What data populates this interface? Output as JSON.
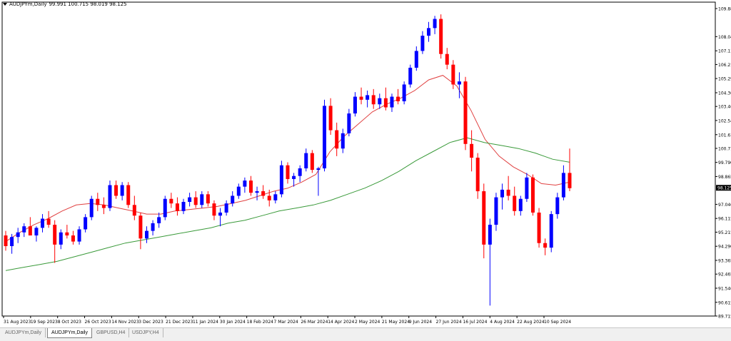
{
  "header": {
    "symbol": "AUDJPYm,Daily",
    "ohlc": "99.991 100.715 98.019 98.125"
  },
  "chart_data": {
    "type": "line",
    "title": "AUDJPYm,Daily",
    "ylim": [
      89.715,
      109.88
    ],
    "y_ticks": [
      "109.88",
      "108.04",
      "107.11",
      "106.21",
      "105.29",
      "104.36",
      "103.46",
      "102.54",
      "101.61",
      "100.71",
      "99.790",
      "98.865",
      "97.040",
      "96.115",
      "95.215",
      "94.290",
      "93.365",
      "92.465",
      "91.540",
      "90.615",
      "89.715"
    ],
    "x_ticks": [
      "31 Aug 2023",
      "19 Sep 2023",
      "8 Oct 2023",
      "26 Oct 2023",
      "14 Nov 2023",
      "3 Dec 2023",
      "21 Dec 2023",
      "11 Jan 2024",
      "30 Jan 2024",
      "18 Feb 2024",
      "7 Mar 2024",
      "26 Mar 2024",
      "14 Apr 2024",
      "2 May 2024",
      "21 May 2024",
      "9 Jun 2024",
      "27 Jun 2024",
      "16 Jul 2024",
      "4 Aug 2024",
      "22 Aug 2024",
      "10 Sep 2024"
    ],
    "current_price": "98.125",
    "current_price_color": "#000000",
    "bull_color": "#0000ff",
    "bear_color": "#ff0000",
    "series": [
      {
        "color": "#e04040",
        "values": [
          94.6,
          95.2,
          95.7,
          96.1,
          96.6,
          97.0,
          97.1,
          97.0,
          96.8,
          96.6,
          96.4,
          96.4,
          96.6,
          96.7,
          96.8,
          96.9,
          97.1,
          97.3,
          97.6,
          97.9,
          98.1,
          98.5,
          99.0,
          100.5,
          101.5,
          102.3,
          103.1,
          103.6,
          104.0,
          104.5,
          105.2,
          105.5,
          104.8,
          103.2,
          101.3,
          100.2,
          99.5,
          99.0,
          98.4,
          98.3,
          98.5
        ]
      },
      {
        "color": "#3a9a3a",
        "values": [
          92.7,
          92.9,
          93.1,
          93.3,
          93.6,
          93.9,
          94.2,
          94.5,
          94.7,
          94.9,
          95.1,
          95.3,
          95.5,
          95.8,
          96.0,
          96.3,
          96.6,
          96.8,
          97.0,
          97.3,
          97.7,
          98.1,
          98.6,
          99.2,
          99.9,
          100.5,
          101.1,
          101.4,
          101.1,
          100.9,
          100.7,
          100.4,
          100.0,
          99.8
        ]
      }
    ],
    "candles": [
      [
        95.0,
        95.3,
        94.0,
        94.3
      ],
      [
        94.3,
        95.1,
        93.8,
        94.9
      ],
      [
        94.9,
        95.5,
        94.5,
        95.2
      ],
      [
        95.2,
        95.8,
        94.9,
        95.6
      ],
      [
        95.6,
        96.2,
        95.2,
        95.0
      ],
      [
        95.0,
        95.6,
        94.6,
        95.5
      ],
      [
        95.5,
        96.4,
        95.2,
        96.1
      ],
      [
        96.1,
        96.6,
        95.5,
        95.7
      ],
      [
        95.7,
        96.0,
        93.2,
        94.4
      ],
      [
        94.4,
        95.4,
        94.1,
        95.2
      ],
      [
        95.2,
        95.7,
        94.8,
        95.0
      ],
      [
        95.0,
        95.3,
        94.4,
        94.6
      ],
      [
        94.6,
        95.6,
        94.4,
        95.4
      ],
      [
        95.4,
        96.4,
        95.2,
        96.2
      ],
      [
        96.2,
        97.6,
        96.0,
        97.4
      ],
      [
        97.4,
        97.8,
        96.6,
        97.0
      ],
      [
        97.0,
        97.5,
        96.4,
        96.8
      ],
      [
        96.8,
        98.6,
        96.6,
        98.3
      ],
      [
        98.3,
        98.6,
        97.4,
        97.6
      ],
      [
        97.6,
        98.5,
        97.3,
        98.3
      ],
      [
        98.3,
        98.5,
        96.8,
        97.0
      ],
      [
        97.0,
        97.6,
        96.0,
        96.3
      ],
      [
        96.3,
        96.5,
        94.1,
        94.8
      ],
      [
        94.8,
        95.6,
        94.5,
        95.3
      ],
      [
        95.3,
        96.0,
        95.0,
        95.8
      ],
      [
        95.8,
        96.5,
        95.5,
        96.2
      ],
      [
        96.2,
        97.6,
        96.0,
        97.4
      ],
      [
        97.4,
        97.8,
        96.8,
        97.1
      ],
      [
        97.1,
        97.5,
        96.3,
        96.6
      ],
      [
        96.6,
        97.4,
        96.4,
        97.2
      ],
      [
        97.2,
        97.8,
        96.9,
        97.5
      ],
      [
        97.5,
        97.9,
        96.8,
        97.0
      ],
      [
        97.0,
        97.9,
        96.8,
        97.7
      ],
      [
        97.7,
        97.9,
        96.9,
        97.1
      ],
      [
        97.1,
        97.3,
        96.0,
        96.3
      ],
      [
        96.3,
        96.8,
        95.6,
        96.5
      ],
      [
        96.5,
        97.3,
        96.3,
        97.1
      ],
      [
        97.1,
        97.9,
        96.9,
        97.6
      ],
      [
        97.6,
        98.4,
        97.4,
        98.2
      ],
      [
        98.2,
        98.8,
        97.8,
        98.6
      ],
      [
        98.6,
        98.9,
        97.6,
        97.8
      ],
      [
        97.8,
        98.2,
        97.3,
        97.9
      ],
      [
        97.9,
        98.3,
        97.4,
        97.6
      ],
      [
        97.6,
        98.0,
        96.9,
        97.3
      ],
      [
        97.3,
        97.9,
        97.1,
        97.7
      ],
      [
        97.7,
        99.9,
        97.5,
        99.6
      ],
      [
        99.6,
        99.8,
        98.4,
        98.7
      ],
      [
        98.7,
        99.1,
        98.2,
        98.9
      ],
      [
        98.9,
        99.6,
        98.5,
        99.4
      ],
      [
        99.4,
        100.7,
        99.2,
        100.4
      ],
      [
        100.4,
        100.6,
        99.1,
        99.3
      ],
      [
        99.3,
        99.5,
        97.6,
        99.4
      ],
      [
        99.4,
        103.9,
        99.2,
        103.5
      ],
      [
        103.5,
        104.0,
        101.6,
        101.9
      ],
      [
        101.9,
        102.4,
        100.2,
        100.7
      ],
      [
        100.7,
        102.0,
        100.4,
        101.7
      ],
      [
        101.7,
        103.3,
        101.5,
        103.0
      ],
      [
        103.0,
        104.4,
        102.8,
        104.1
      ],
      [
        104.1,
        104.7,
        103.6,
        103.9
      ],
      [
        103.9,
        104.5,
        103.4,
        104.2
      ],
      [
        104.2,
        104.6,
        103.3,
        103.6
      ],
      [
        103.6,
        104.3,
        103.3,
        104.0
      ],
      [
        104.0,
        104.7,
        103.2,
        103.4
      ],
      [
        103.4,
        104.3,
        103.1,
        104.1
      ],
      [
        104.1,
        104.6,
        103.6,
        103.8
      ],
      [
        103.8,
        105.1,
        103.6,
        104.9
      ],
      [
        104.9,
        106.2,
        104.7,
        106.0
      ],
      [
        106.0,
        107.4,
        105.8,
        107.1
      ],
      [
        107.1,
        108.4,
        106.9,
        108.1
      ],
      [
        108.1,
        109.0,
        107.7,
        108.6
      ],
      [
        108.6,
        109.4,
        108.2,
        109.2
      ],
      [
        109.2,
        109.5,
        106.6,
        106.9
      ],
      [
        106.9,
        107.3,
        105.9,
        106.2
      ],
      [
        106.2,
        106.5,
        104.6,
        104.9
      ],
      [
        104.9,
        105.7,
        104.0,
        105.1
      ],
      [
        105.1,
        105.4,
        100.6,
        101.0
      ],
      [
        101.0,
        101.9,
        99.2,
        100.1
      ],
      [
        100.1,
        100.4,
        97.4,
        97.9
      ],
      [
        97.9,
        98.4,
        93.5,
        94.4
      ],
      [
        94.4,
        96.1,
        90.4,
        95.7
      ],
      [
        95.7,
        97.8,
        95.3,
        97.5
      ],
      [
        97.5,
        98.4,
        96.7,
        98.0
      ],
      [
        98.0,
        98.9,
        97.3,
        97.6
      ],
      [
        97.6,
        98.2,
        96.3,
        96.6
      ],
      [
        96.6,
        97.6,
        96.3,
        97.4
      ],
      [
        97.4,
        99.1,
        97.2,
        98.8
      ],
      [
        98.8,
        99.0,
        96.3,
        96.5
      ],
      [
        96.5,
        96.8,
        94.2,
        94.5
      ],
      [
        94.5,
        94.8,
        93.7,
        94.2
      ],
      [
        94.2,
        96.6,
        93.9,
        96.4
      ],
      [
        96.4,
        97.8,
        96.1,
        97.5
      ],
      [
        97.5,
        99.6,
        97.3,
        99.1
      ],
      [
        99.1,
        100.7,
        97.9,
        98.1
      ]
    ]
  },
  "tabs": [
    {
      "label": "AUDJPYm,Daily"
    },
    {
      "label": "AUDJPYm,Daily"
    },
    {
      "label": "GBPUSD,H4"
    },
    {
      "label": "USDJPY,H4"
    }
  ]
}
